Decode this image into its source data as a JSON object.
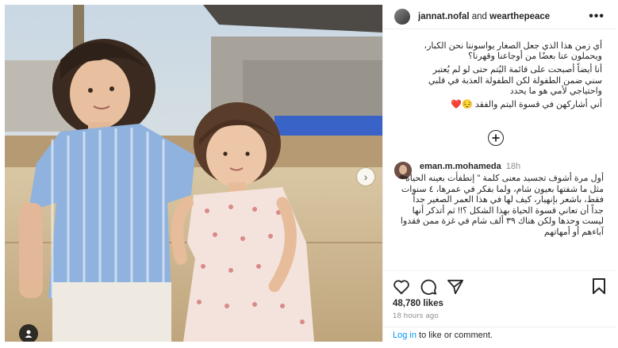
{
  "post": {
    "author": "jannat.nofal",
    "connector": "and",
    "collaborator": "wearthepeace",
    "more_label": "•••"
  },
  "caption": {
    "p1": "أي زمن هذا الذي جعل الصغار يواسوننا نحن الكبار، ويحملون عنا بعضًا من أوجاعنا وقهرنا؟",
    "p2": "أنا أيضاً أصبحت على قائمة اليُتم حتى لو لم يُعتبر سني ضمن الطفولة لكن الطفولة العذبة في قلبي واحتياجي لأمي هو ما يحدد",
    "p3": "أني أشاركهن في قسوة اليتم والفقد 😔❤️"
  },
  "comment": {
    "username": "eman.m.mohameda",
    "time": "18h",
    "text": "أول مرة أشوف تجسيد معنى كلمة \" إنطفأت بعينه الحياة \" مثل ما شفتها بعيون شام، ولما بفكر في عمرها، ٤ سنوات فقط، باشعر بإنهيار، كيف لها في هذا العمر الصغير جداً جداً أن تعاني قسوة الحياة بهذا الشكل ؟!! ثم أتذكر أنها ليست وحدها ولكن هناك ٣٩ ألف شام في غزة ممن فقدوا آباءهم أو أمهاتهم"
  },
  "stats": {
    "likes": "48,780 likes",
    "time_ago": "18 hours ago"
  },
  "login": {
    "link": "Log in",
    "rest": " to like or comment."
  },
  "icons": {
    "heart": "heart-icon",
    "comment": "comment-icon",
    "share": "share-icon",
    "save": "bookmark-icon",
    "more": "more-icon",
    "add": "plus-circle-icon",
    "next": "chevron-right-icon",
    "user_tag": "user-tag-icon"
  },
  "colors": {
    "link_blue": "#0095f6",
    "text": "#262626",
    "muted": "#8e8e8e"
  }
}
